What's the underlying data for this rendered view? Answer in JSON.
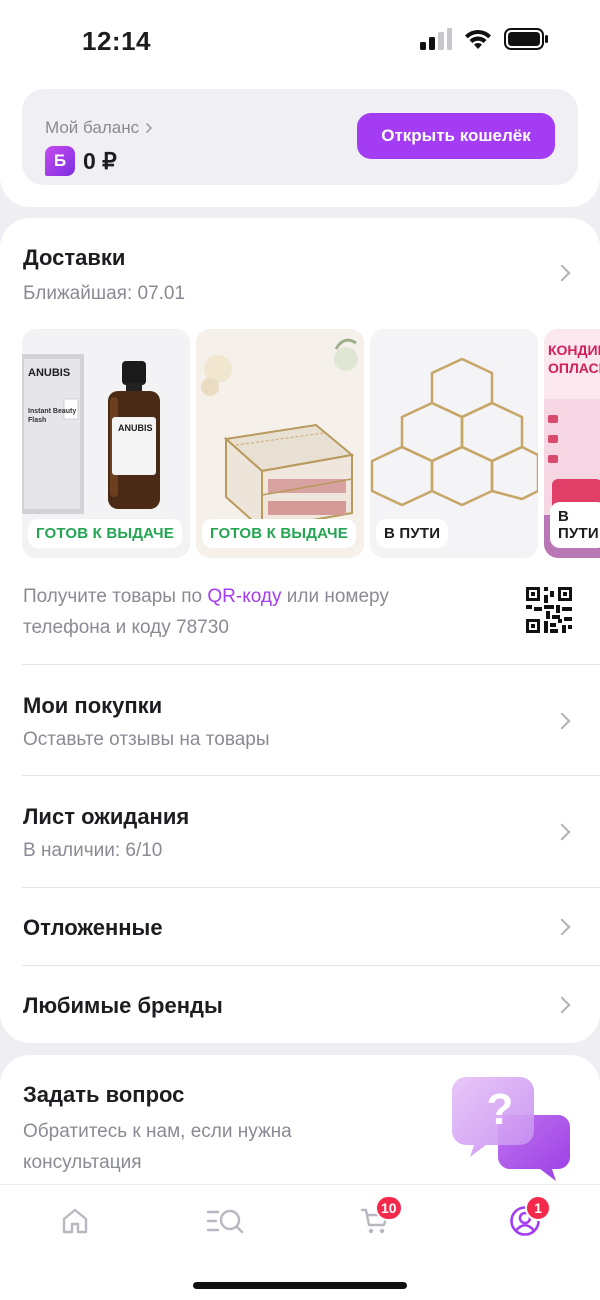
{
  "status_bar": {
    "time": "12:14"
  },
  "balance": {
    "label": "Мой баланс",
    "badge_letter": "Б",
    "value": "0 ₽",
    "wallet_button": "Открыть кошелёк"
  },
  "deliveries": {
    "title": "Доставки",
    "subtitle": "Ближайшая: 07.01",
    "items": [
      {
        "status": "ГОТОВ К ВЫДАЧЕ",
        "brand": "ANUBIS",
        "product_text": "Instant Beauty Flash"
      },
      {
        "status": "ГОТОВ К ВЫДАЧЕ"
      },
      {
        "status": "В ПУТИ"
      },
      {
        "status": "В ПУТИ",
        "product_text": "КОНДИЦ ОПЛАСК"
      }
    ],
    "qr_text_before": "Получите товары по ",
    "qr_link": "QR-коду",
    "qr_text_after": " или номеру телефона и коду 78730"
  },
  "menu": [
    {
      "title": "Мои покупки",
      "subtitle": "Оставьте отзывы на товары"
    },
    {
      "title": "Лист ожидания",
      "subtitle": "В наличии: 6/10"
    },
    {
      "title": "Отложенные"
    },
    {
      "title": "Любимые бренды"
    }
  ],
  "help": {
    "title": "Задать вопрос",
    "subtitle": "Обратитесь к нам, если нужна консультация",
    "icon_glyph": "?"
  },
  "tabbar": {
    "cart_badge": "10",
    "profile_badge": "1"
  },
  "colors": {
    "accent": "#a33cf2",
    "green": "#23a552",
    "badge_red": "#f5294c"
  }
}
